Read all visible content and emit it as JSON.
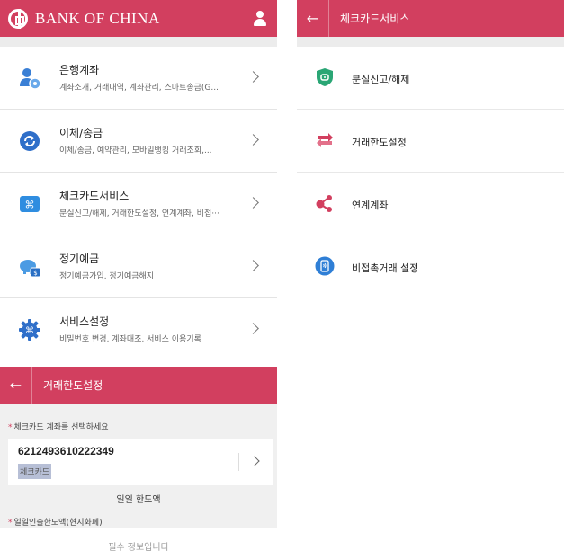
{
  "colors": {
    "brand": "#d23f5f",
    "divider": "#e4e4e4",
    "background_gray": "#ececec"
  },
  "home": {
    "brand_name": "BANK OF CHINA",
    "menu": [
      {
        "icon": "user-account-icon",
        "title": "은행계좌",
        "subtitle": "계좌소개, 거래내역, 계좌관리, 스마트송금(G..."
      },
      {
        "icon": "refresh-transfer-icon",
        "title": "이체/송금",
        "subtitle": "이체/송금, 예약관리, 모바일뱅킹 거래조회,..."
      },
      {
        "icon": "command-card-icon",
        "title": "체크카드서비스",
        "subtitle": "분실신고/해제, 거래한도설정, 연계계좌, 비접···"
      },
      {
        "icon": "piggy-bank-icon",
        "title": "정기예금",
        "subtitle": "정기예금가입, 정기예금해지"
      },
      {
        "icon": "gear-icon",
        "title": "서비스설정",
        "subtitle": "비밀번호 변경, 계좌대조, 서비스 이용기록"
      }
    ]
  },
  "check_card": {
    "title": "체크카드서비스",
    "items": [
      {
        "icon": "shield-icon",
        "label": "분실신고/해제"
      },
      {
        "icon": "swap-arrows-icon",
        "label": "거래한도설정"
      },
      {
        "icon": "link-nodes-icon",
        "label": "연계계좌"
      },
      {
        "icon": "contactless-phone-icon",
        "label": "비접촉거래 설정"
      }
    ]
  },
  "limit_setting": {
    "title": "거래한도설정",
    "select_account_label": "체크카드 계좌를 선택하세요",
    "account_number": "6212493610222349",
    "account_type": "체크카드",
    "daily_limit_label": "일일 한도액",
    "daily_withdraw_label": "일일인출한도액(현지화폐)",
    "required_message": "필수 정보입니다"
  }
}
